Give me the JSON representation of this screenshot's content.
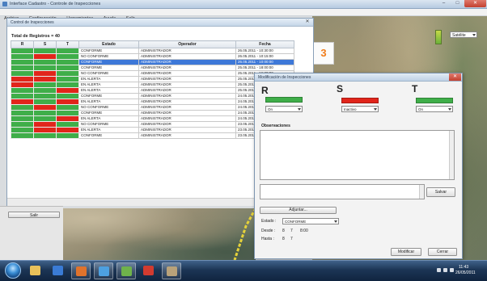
{
  "window": {
    "title": "Interface Cadastro - Controle de Inspecciones",
    "min": "–",
    "max": "□",
    "close": "✕"
  },
  "menu": [
    "Archivo",
    "Configuración",
    "Herramientas",
    "Ayuda",
    "Salir"
  ],
  "colors": {
    "green": "#3fae49",
    "red": "#e1251b",
    "selection": "#3d78d8",
    "marker": "#f07c1a"
  },
  "inspections": {
    "title": "Control de Inspecciones",
    "close": "✕",
    "count_label": "Total de Registros = 40",
    "headers": [
      "R",
      "S",
      "T",
      "Estado",
      "Operador",
      "Fecha"
    ],
    "selected_row": 2,
    "rows": [
      {
        "r": "green",
        "s": "green",
        "t": "green",
        "estado": "CONFORME",
        "operador": "ADMINISTRADOR",
        "fecha": "26.05.2011 - 10:30:00"
      },
      {
        "r": "green",
        "s": "red",
        "t": "green",
        "estado": "NO CONFORME",
        "operador": "ADMINISTRADOR",
        "fecha": "26.05.2011 - 10:15:00"
      },
      {
        "r": "green",
        "s": "green",
        "t": "green",
        "estado": "CONFORME",
        "operador": "ADMINISTRADOR",
        "fecha": "26.05.2011 - 10:00:00"
      },
      {
        "r": "green",
        "s": "green",
        "t": "green",
        "estado": "CONFORME",
        "operador": "ADMINISTRADOR",
        "fecha": "25.05.2011 - 18:00:00"
      },
      {
        "r": "green",
        "s": "red",
        "t": "green",
        "estado": "NO CONFORME",
        "operador": "ADMINISTRADOR",
        "fecha": "25.05.2011 - 16:30:00"
      },
      {
        "r": "red",
        "s": "red",
        "t": "green",
        "estado": "EN ALERTA",
        "operador": "ADMINISTRADOR",
        "fecha": "25.05.2011 - 14:00:00"
      },
      {
        "r": "red",
        "s": "green",
        "t": "green",
        "estado": "EN ALERTA",
        "operador": "ADMINISTRADOR",
        "fecha": "25.05.2011 - 12:00:00"
      },
      {
        "r": "green",
        "s": "green",
        "t": "red",
        "estado": "EN ALERTA",
        "operador": "ADMINISTRADOR",
        "fecha": "25.05.2011 - 10:00:00"
      },
      {
        "r": "green",
        "s": "green",
        "t": "green",
        "estado": "CONFORME",
        "operador": "ADMINISTRADOR",
        "fecha": "24.05.2011 - 18:00:00"
      },
      {
        "r": "red",
        "s": "green",
        "t": "red",
        "estado": "EN ALERTA",
        "operador": "ADMINISTRADOR",
        "fecha": "24.05.2011 - 16:00:00"
      },
      {
        "r": "green",
        "s": "red",
        "t": "green",
        "estado": "NO CONFORME",
        "operador": "ADMINISTRADOR",
        "fecha": "24.05.2011 - 14:00:00"
      },
      {
        "r": "green",
        "s": "green",
        "t": "green",
        "estado": "CONFORME",
        "operador": "ADMINISTRADOR",
        "fecha": "24.05.2011 - 12:00:00"
      },
      {
        "r": "green",
        "s": "green",
        "t": "red",
        "estado": "EN ALERTA",
        "operador": "ADMINISTRADOR",
        "fecha": "24.05.2011 - 10:00:00"
      },
      {
        "r": "green",
        "s": "red",
        "t": "green",
        "estado": "NO CONFORME",
        "operador": "ADMINISTRADOR",
        "fecha": "23.05.2011 - 18:00:00"
      },
      {
        "r": "green",
        "s": "red",
        "t": "red",
        "estado": "EN ALERTA",
        "operador": "ADMINISTRADOR",
        "fecha": "23.05.2011 - 16:00:00"
      },
      {
        "r": "green",
        "s": "green",
        "t": "green",
        "estado": "CONFORME",
        "operador": "ADMINISTRADOR",
        "fecha": "23.05.2011 - 14:00:00"
      }
    ]
  },
  "map": {
    "marker": "3",
    "type": "Satélite"
  },
  "left_panel": {
    "exit_button": "Salir"
  },
  "dialog": {
    "title": "Modificación de Inspecciones",
    "close": "✕",
    "phases": [
      {
        "label": "R",
        "status": "green",
        "value": "On"
      },
      {
        "label": "S",
        "status": "red",
        "value": "Inactivo"
      },
      {
        "label": "T",
        "status": "green",
        "value": "On"
      }
    ],
    "observations_label": "Observaciones",
    "save_button": "Salvar",
    "attach_button": "Adjuntar...",
    "state_label": "Estado :",
    "state_value": "CONFORME",
    "from_label": "Desde :",
    "from_values": [
      "8",
      "7",
      "8:00"
    ],
    "to_label": "Hasta :",
    "to_values": [
      "8",
      "7"
    ],
    "modify_button": "Modificar",
    "close_button": "Cerrar"
  },
  "taskbar": {
    "pinned": [
      {
        "icon": "folder-icon",
        "color": "#e8c15a",
        "active": false
      },
      {
        "icon": "media-player-icon",
        "color": "#3a7bd5",
        "active": false
      },
      {
        "icon": "browser-icon",
        "color": "#e0732c",
        "active": true
      },
      {
        "icon": "explorer-icon",
        "color": "#4da0e0",
        "active": true
      },
      {
        "icon": "application-icon",
        "color": "#6fb24b",
        "active": true
      },
      {
        "icon": "document-icon",
        "color": "#d23b30",
        "active": false
      },
      {
        "icon": "map-app-icon",
        "color": "#b9a27a",
        "active": true
      }
    ],
    "clock": {
      "time": "11:43",
      "date": "26/05/2011"
    }
  }
}
